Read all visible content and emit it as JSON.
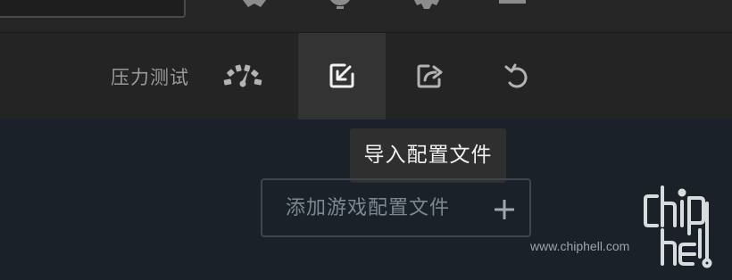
{
  "toolbar": {
    "stress_test_label": "压力测试",
    "buttons": [
      {
        "name": "stress-gauge",
        "icon": "speedometer-icon"
      },
      {
        "name": "import-profile",
        "icon": "import-icon",
        "active": true
      },
      {
        "name": "export-profile",
        "icon": "export-icon"
      },
      {
        "name": "reset",
        "icon": "undo-icon"
      }
    ]
  },
  "tooltip": {
    "text": "导入配置文件"
  },
  "add_profile": {
    "label": "添加游戏配置文件",
    "icon": "plus-icon"
  },
  "watermark": {
    "url": "www.chiphell.com",
    "logo": "chiphell"
  },
  "colors": {
    "background": "#1b2129",
    "toolbar": "#242424",
    "active_button": "#333333",
    "tooltip": "#2f2f2f",
    "border": "#3c4651"
  }
}
